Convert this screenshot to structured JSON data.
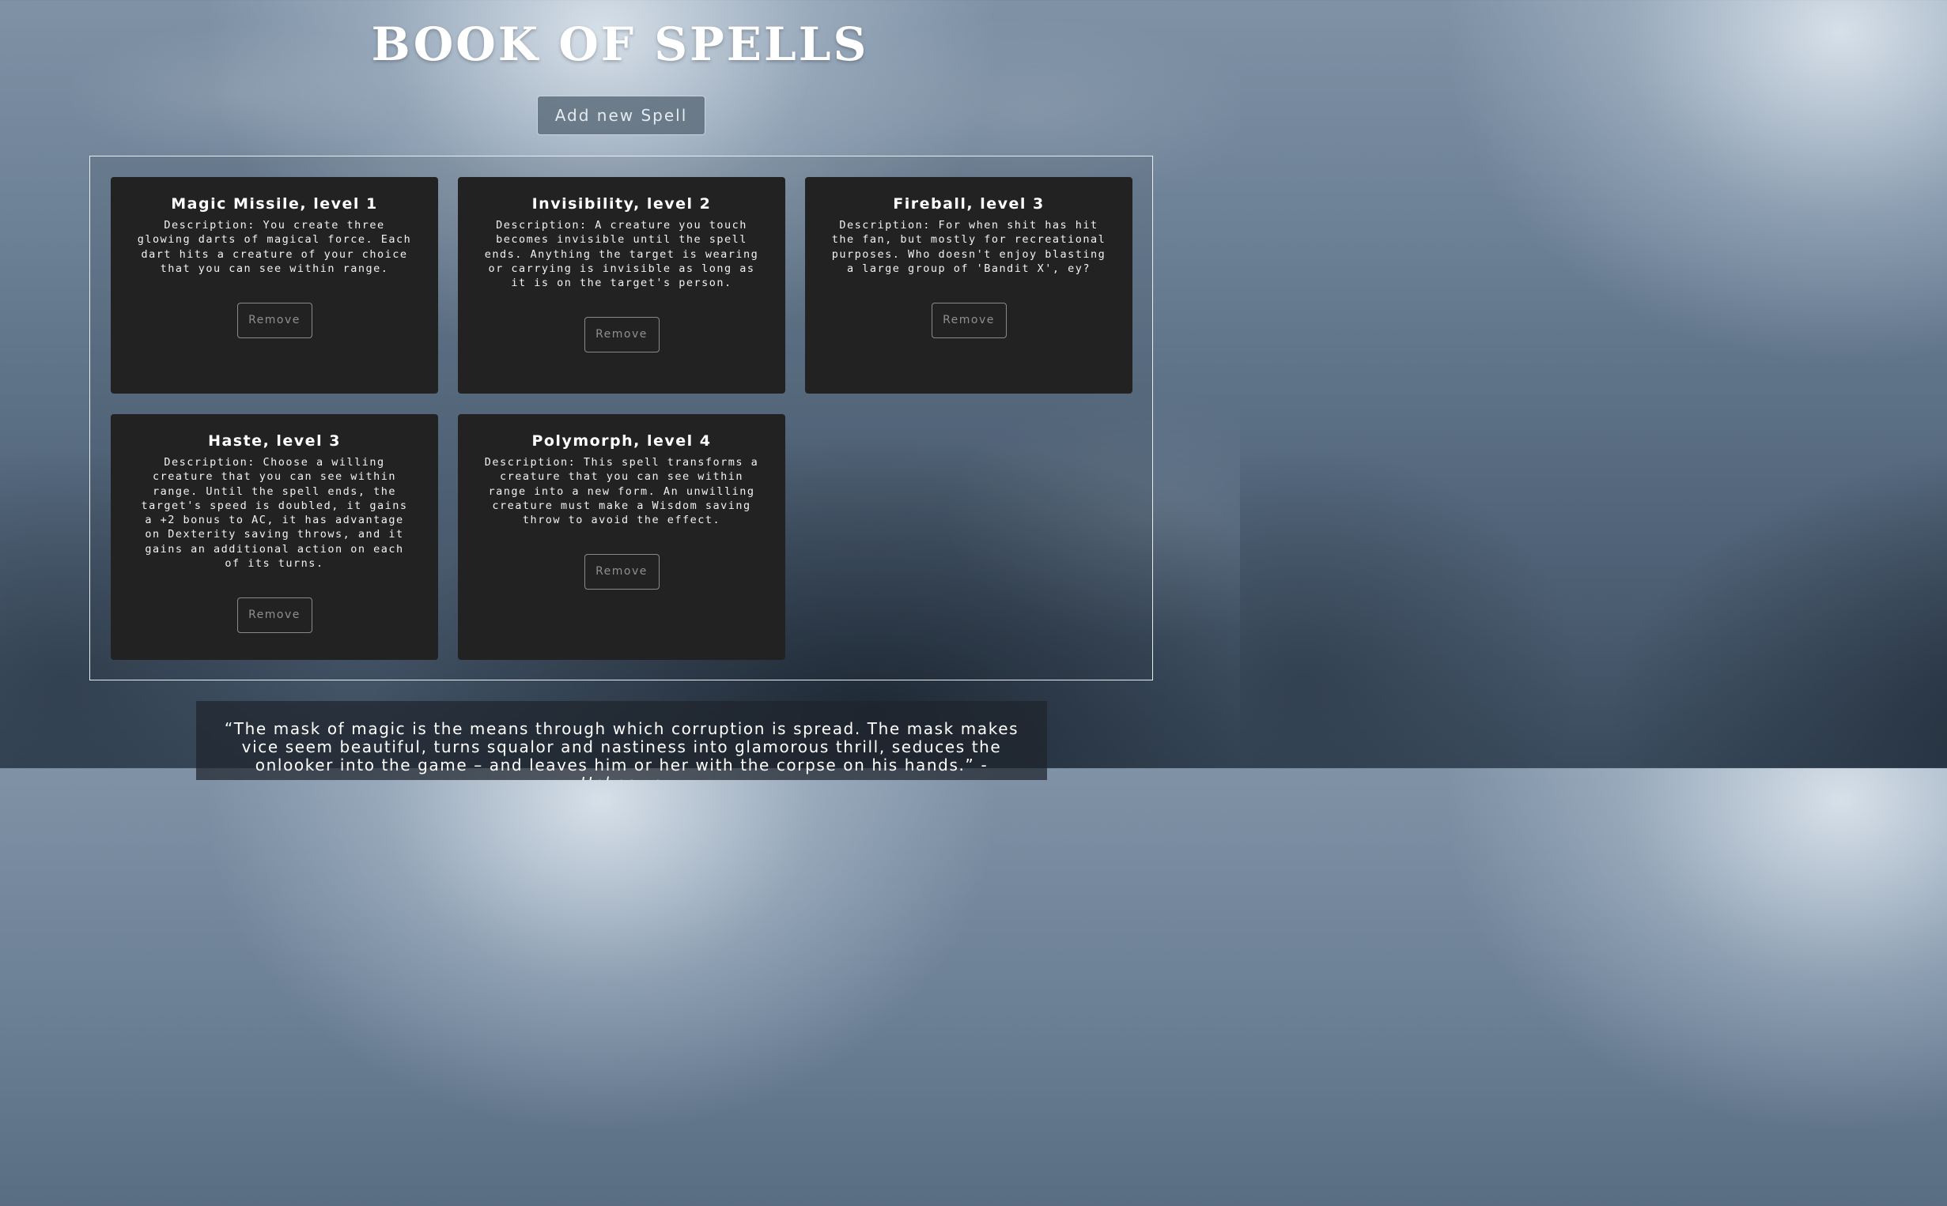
{
  "page": {
    "title": "BOOK OF SPELLS",
    "add_button_label": "Add new Spell"
  },
  "spells": [
    {
      "name": "Magic Missile, level 1",
      "description": "Description: You create three glowing darts of magical force. Each dart hits a creature of your choice that you can see within range.",
      "remove_label": "Remove"
    },
    {
      "name": "Invisibility, level 2",
      "description": "Description: A creature you touch becomes invisible until the spell ends. Anything the target is wearing or carrying is invisible as long as it is on the target's person.",
      "remove_label": "Remove"
    },
    {
      "name": "Fireball, level 3",
      "description": "Description: For when shit has hit the fan, but mostly for recreational purposes. Who doesn't enjoy blasting a large group of 'Bandit X', ey?",
      "remove_label": "Remove"
    },
    {
      "name": "Haste, level 3",
      "description": "Description: Choose a willing creature that you can see within range. Until the spell ends, the target's speed is doubled, it gains a +2 bonus to AC, it has advantage on Dexterity saving throws, and it gains an additional action on each of its turns.",
      "remove_label": "Remove"
    },
    {
      "name": "Polymorph, level 4",
      "description": "Description: This spell transforms a creature that you can see within range into a new form. An unwilling creature must make a Wisdom saving throw to avoid the effect.",
      "remove_label": "Remove"
    }
  ],
  "quote": {
    "text": "“The mask of magic is the means through which corruption is spread. The mask makes vice seem beautiful, turns squalor and nastiness into glamorous thrill, seduces the onlooker into the game – and leaves him or her with the corpse on his hands.”",
    "author": "-Unknown"
  },
  "colors": {
    "card_background": "#222222",
    "container_border": "#e8edf2",
    "remove_button_text": "#8f8f8f"
  }
}
